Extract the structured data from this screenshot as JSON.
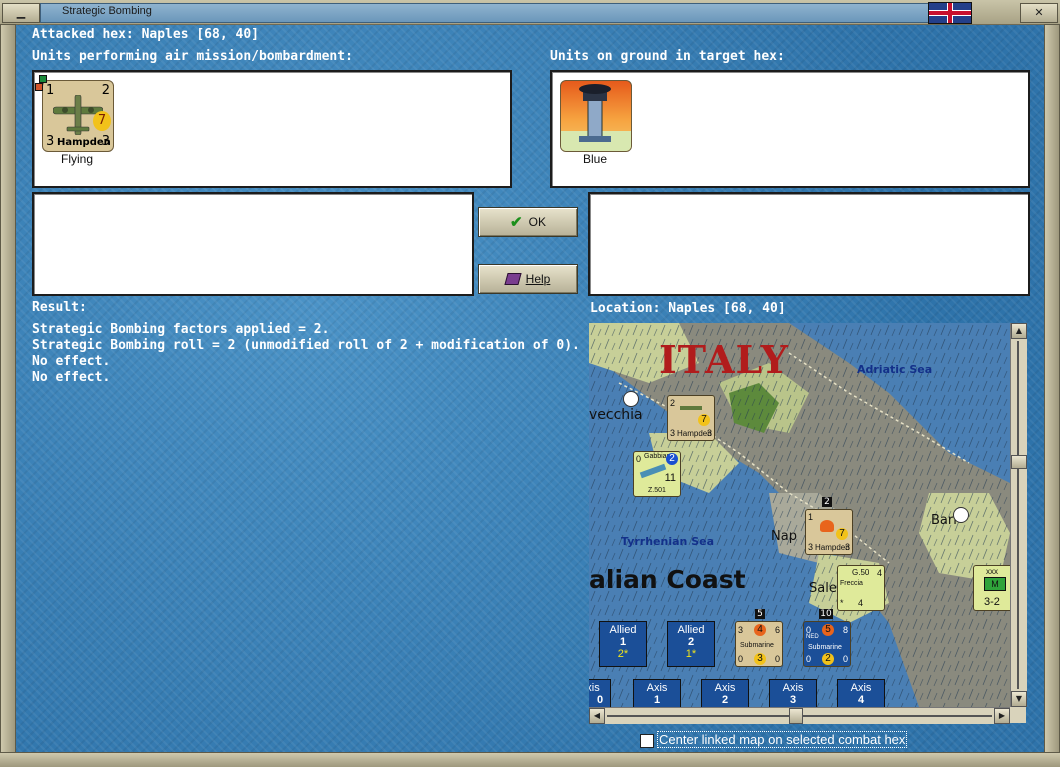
{
  "window": {
    "title": "Strategic Bombing"
  },
  "header": {
    "attacked_hex": "Attacked hex: Naples  [68, 40]"
  },
  "air_panel": {
    "label": "Units performing air mission/bombardment:",
    "units": [
      {
        "name": "Hampden",
        "status": "Flying",
        "stats": [
          "1",
          "2",
          "7",
          "3",
          "3"
        ]
      }
    ]
  },
  "ground_panel": {
    "label": "Units on ground in target hex:",
    "units": [
      {
        "status": "Blue"
      }
    ]
  },
  "buttons": {
    "ok": "OK",
    "help": "Help"
  },
  "result": {
    "label": "Result:",
    "lines": [
      "Strategic Bombing factors applied = 2.",
      "Strategic Bombing roll = 2 (unmodified roll of 2 + modification of 0).",
      "No effect.",
      "No effect."
    ]
  },
  "location": {
    "label": "Location:  Naples  [68, 40]"
  },
  "map": {
    "country_label": "ITALY",
    "sea_labels": [
      "Adriatic Sea",
      "Tyrrhenian Sea"
    ],
    "coast_label": "alian Coast",
    "city_labels": [
      "vecchia",
      "Bari",
      "Nap",
      "Sale"
    ],
    "counters": {
      "hampden_top": {
        "name": "Hampden",
        "a": "2",
        "b": "7",
        "c": "3",
        "d": "3"
      },
      "gabbiano": {
        "name": "Gabbiano",
        "sub": "Z.501",
        "a": "0",
        "b": "2",
        "c": "11"
      },
      "hampden_naples": {
        "name": "Hampden",
        "a": "1",
        "b": "7",
        "c": "3",
        "d": "3",
        "stack": "2"
      },
      "g50": {
        "name": "G.50",
        "sub": "Freccia",
        "a": "4",
        "b": "4",
        "c": "*"
      },
      "submarine_allied": {
        "name": "Submarine",
        "a": "3",
        "b": "4",
        "c": "6",
        "d": "0",
        "e": "3",
        "f": "0",
        "stack": "5"
      },
      "submarine_axis": {
        "name": "Submarine",
        "nation": "NED",
        "a": "0",
        "b": "5",
        "c": "8",
        "d": "0",
        "e": "2",
        "f": "0",
        "stack": "10"
      },
      "xxx": {
        "top": "xxx",
        "mid": "M",
        "bottom": "3-2"
      }
    },
    "boxes": [
      {
        "side": "Allied",
        "num": "1",
        "extra": "2*"
      },
      {
        "side": "Allied",
        "num": "2",
        "extra": "1*"
      },
      {
        "side": "Axis",
        "num": "1",
        "extra": ""
      },
      {
        "side": "Axis",
        "num": "2",
        "extra": ""
      },
      {
        "side": "Axis",
        "num": "3",
        "extra": ""
      },
      {
        "side": "Axis",
        "num": "4",
        "extra": ""
      },
      {
        "side": "xis",
        "num": "0",
        "extra": ""
      }
    ]
  },
  "options": {
    "center_map_label": "Center linked map on selected combat hex"
  },
  "colors": {
    "panel_bg": "#3a82b8",
    "title_bar": "#c9c4a8",
    "map_axis_red": "#b11c1c"
  }
}
